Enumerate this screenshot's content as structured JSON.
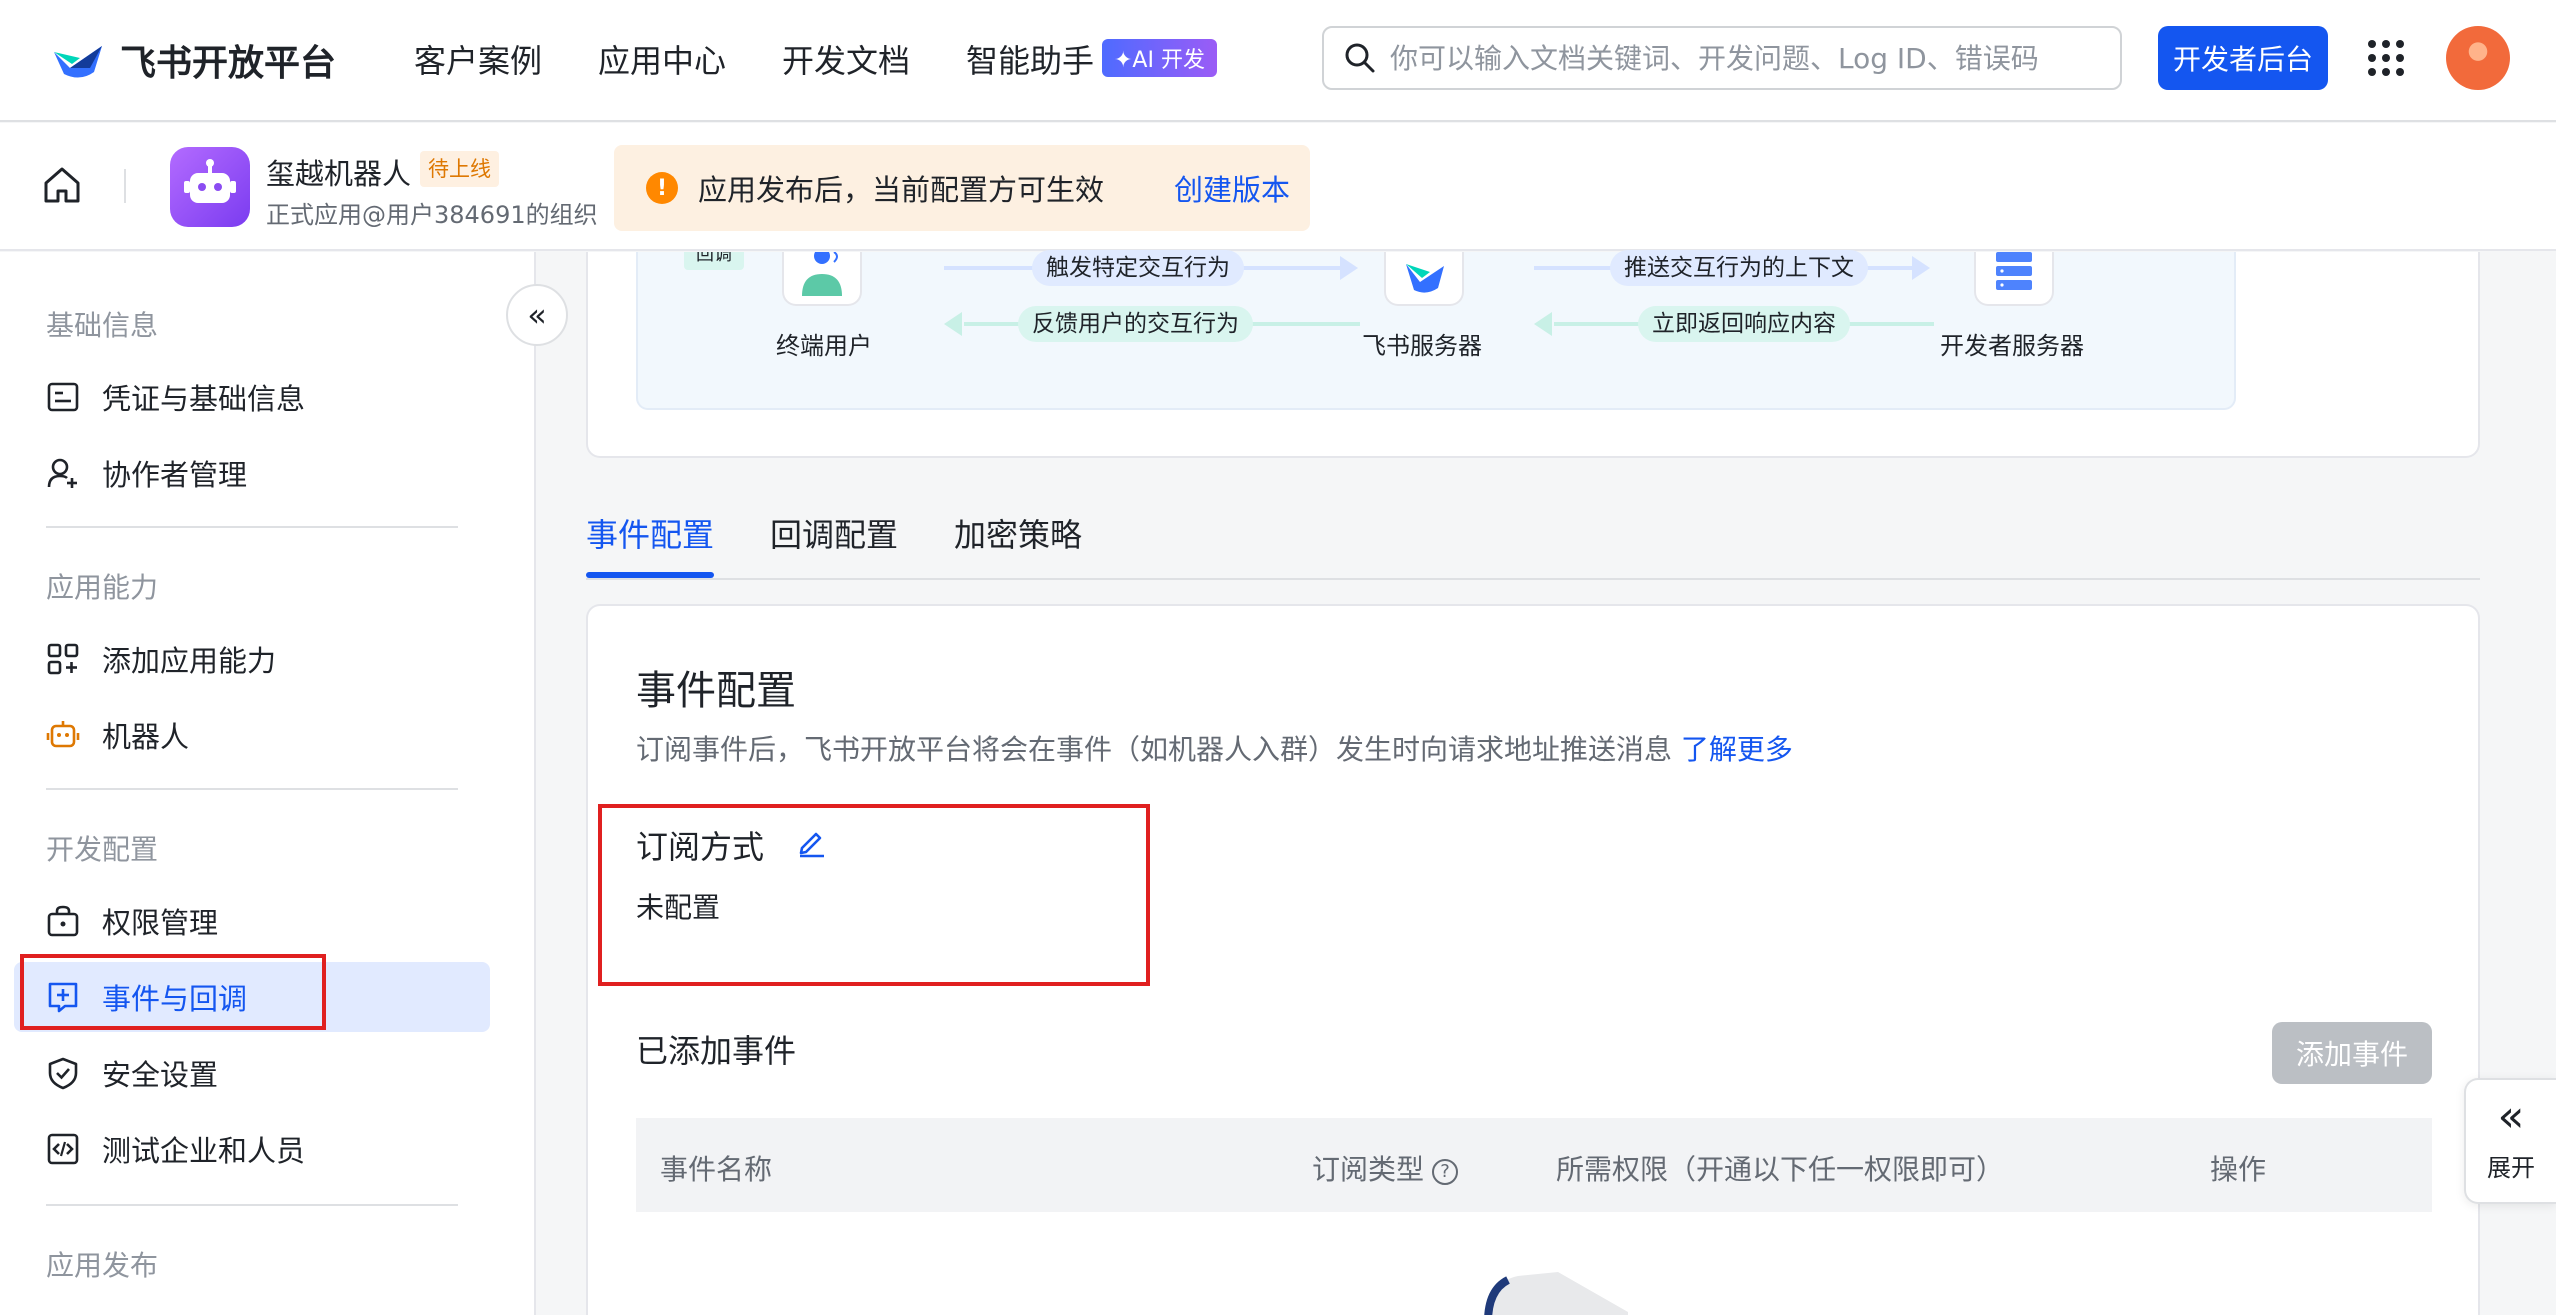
{
  "topnav": {
    "logo_text": "飞书开放平台",
    "links": [
      "客户案例",
      "应用中心",
      "开发文档",
      "智能助手"
    ],
    "ai_badge": "✦AI 开发",
    "search_placeholder": "你可以输入文档关键词、开发问题、Log ID、错误码",
    "dev_console_label": "开发者后台"
  },
  "appbar": {
    "app_name": "玺越机器人",
    "app_status": "待上线",
    "app_org": "正式应用@用户384691的组织",
    "publish_tip": "应用发布后，当前配置方可生效",
    "create_version": "创建版本"
  },
  "sidebar": {
    "groups": [
      "基础信息",
      "应用能力",
      "开发配置",
      "应用发布"
    ],
    "items": [
      {
        "label": "凭证与基础信息",
        "icon": "id-card-icon"
      },
      {
        "label": "协作者管理",
        "icon": "user-add-icon"
      },
      {
        "label": "添加应用能力",
        "icon": "apps-add-icon"
      },
      {
        "label": "机器人",
        "icon": "robot-icon"
      },
      {
        "label": "权限管理",
        "icon": "lock-icon"
      },
      {
        "label": "事件与回调",
        "icon": "event-add-icon"
      },
      {
        "label": "安全设置",
        "icon": "shield-icon"
      },
      {
        "label": "测试企业和人员",
        "icon": "code-box-icon"
      }
    ],
    "active": "事件与回调",
    "collapse_glyph": "«"
  },
  "flow": {
    "callback_tag": "回调",
    "nodes": [
      "终端用户",
      "飞书服务器",
      "开发者服务器"
    ],
    "arrows": [
      "触发特定交互行为",
      "反馈用户的交互行为",
      "推送交互行为的上下文",
      "立即返回响应内容"
    ]
  },
  "tabs": [
    "事件配置",
    "回调配置",
    "加密策略"
  ],
  "event_config": {
    "title": "事件配置",
    "desc": "订阅事件后，飞书开放平台将会在事件（如机器人入群）发生时向请求地址推送消息",
    "learn_more": "了解更多",
    "sub_mode_label": "订阅方式",
    "sub_mode_value": "未配置",
    "added_title": "已添加事件",
    "add_event_label": "添加事件",
    "table_headers": [
      "事件名称",
      "订阅类型",
      "所需权限（开通以下任一权限即可）",
      "操作"
    ]
  },
  "expand_panel": {
    "glyph": "«",
    "label": "展开"
  },
  "colors": {
    "primary": "#1456f0",
    "active_bg": "#e1eaff",
    "warning": "#ff8800",
    "annotation_red": "#e02020"
  }
}
